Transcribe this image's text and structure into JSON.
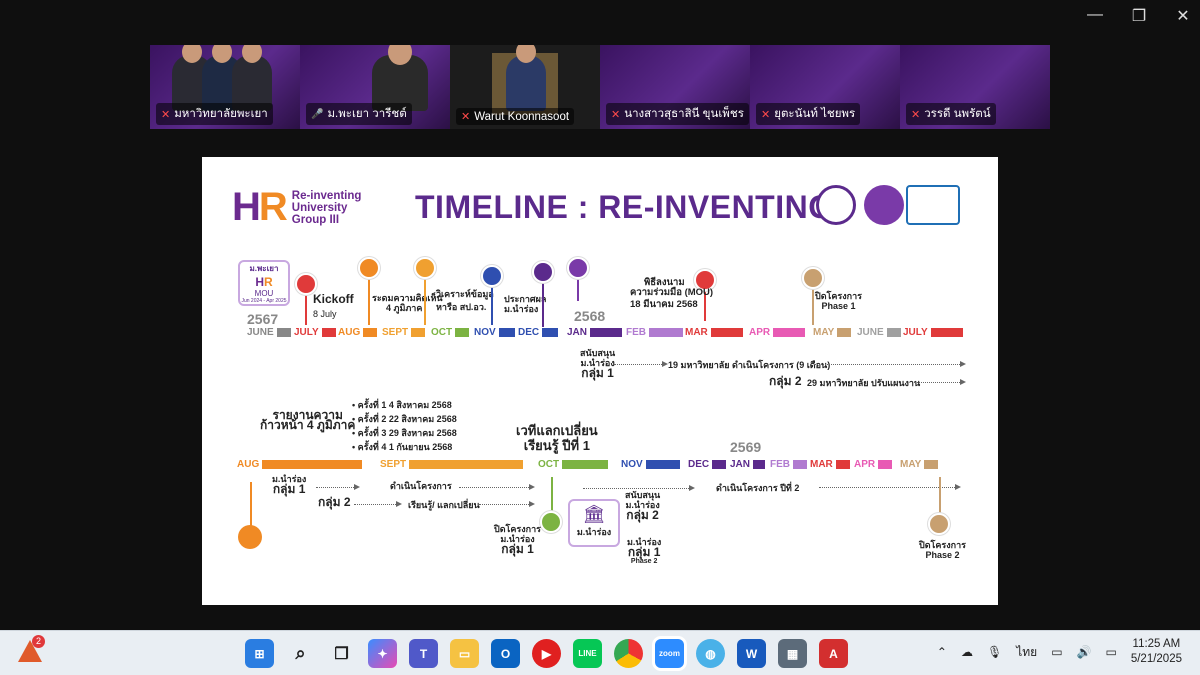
{
  "window_controls": {
    "minimize": "—",
    "restore": "❐",
    "close": "✕"
  },
  "participants": [
    {
      "name": "มหาวิทยาลัยพะเยา",
      "muted": true
    },
    {
      "name": "ม.พะเยา วารีชต์",
      "muted": false
    },
    {
      "name": "Warut Koonnasoot",
      "muted": true
    },
    {
      "name": "นางสาวสุธาสินี ขุนเพ็ชร",
      "muted": true
    },
    {
      "name": "ยุตะนันท์ ไชยพร",
      "muted": true
    },
    {
      "name": "วรรดี นพรัตน์",
      "muted": true
    }
  ],
  "slide": {
    "logo_text": [
      "Re-inventing",
      "University",
      "Group III"
    ],
    "title": "TIMELINE : RE-INVENTING",
    "badge": {
      "top": "ม.พะเยา",
      "bottom": "MOU",
      "dates": "Jun 2024 - Apr 2025"
    },
    "year_2567": "2567",
    "year_2568": "2568",
    "year_2569": "2569",
    "row1_months": [
      "JUNE",
      "JULY",
      "AUG",
      "SEPT",
      "OCT",
      "NOV",
      "DEC",
      "JAN",
      "FEB",
      "MAR",
      "APR",
      "MAY",
      "JUNE",
      "JULY"
    ],
    "kickoff": "Kickoff",
    "kickoff_date": "8 July",
    "ev_aug": [
      "ระดมความคิดเห็น",
      "4 ภูมิภาค"
    ],
    "ev_sept": [
      "วิเคราะห์ข้อมูล",
      "หารือ สป.อว."
    ],
    "ev_nov": [
      "ประกาศผล",
      "ม.นำร่อง"
    ],
    "ev_mou": [
      "พิธีลงนาม",
      "ความร่วมมือ (MOU)",
      "18 มีนาคม 2568"
    ],
    "ev_close1": [
      "ปิดโครงการ",
      "Phase 1"
    ],
    "support1": [
      "สนับสนุน",
      "ม.นำร่อง",
      "กลุ่ม 1"
    ],
    "line19": "19 มหาวิทยาลัย ดำเนินโครงการ (9 เดือน)",
    "group2": "กลุ่ม 2",
    "line29": "29 มหาวิทยาลัย ปรับแผนงาน",
    "report": [
      "รายงานความ",
      "ก้าวหน้า 4 ภูมิภาค"
    ],
    "rounds": [
      "ครั้งที่ 1    4 สิงหาคม  2568",
      "ครั้งที่ 2  22 สิงหาคม  2568",
      "ครั้งที่ 3  29 สิงหาคม  2568",
      "ครั้งที่ 4    1 กันยายน  2568"
    ],
    "forum": [
      "เวทีแลกเปลี่ยน",
      "เรียนรู้ ปีที่ 1"
    ],
    "row2_months": [
      "AUG",
      "SEPT",
      "OCT",
      "NOV",
      "DEC",
      "JAN",
      "FEB",
      "MAR",
      "APR",
      "MAY"
    ],
    "r2_g1": [
      "ม.นำร่อง",
      "กลุ่ม 1"
    ],
    "r2_run": "ดำเนินโครงการ",
    "r2_g2": "กลุ่ม 2",
    "r2_learn": "เรียนรู้/ แลกเปลี่ยน",
    "r2_close": [
      "ปิดโครงการ",
      "ม.นำร่อง",
      "กลุ่ม 1"
    ],
    "r2_uni": "ม.นำร่อง",
    "r2_support": [
      "สนับสนุน",
      "ม.นำร่อง",
      "กลุ่ม 2"
    ],
    "r2_pilot": [
      "ม.นำร่อง",
      "กลุ่ม 1",
      "Phase 2"
    ],
    "r2_year2": "ดำเนินโครงการ ปีที่ 2",
    "r2_close2": [
      "ปิดโครงการ",
      "Phase 2"
    ]
  },
  "taskbar": {
    "notif_count": "2",
    "apps": [
      "start-icon",
      "search-icon",
      "taskview-icon",
      "copilot-icon",
      "teams-icon",
      "explorer-icon",
      "outlook-icon",
      "youtube-icon",
      "line-icon",
      "chrome-icon",
      "zoom-icon",
      "maps-icon",
      "word-icon",
      "calculator-icon",
      "acrobat-icon"
    ],
    "app_labels": {
      "line": "LINE",
      "zoom": "zoom",
      "word": "W"
    },
    "lang": "ไทย",
    "time": "11:25 AM",
    "date": "5/21/2025"
  },
  "colors": {
    "purple": "#5b2a8c",
    "orange": "#f08a24",
    "red": "#e03a3a",
    "green": "#7cb342",
    "blue": "#2f4fb0",
    "pink": "#e85ab4",
    "tan": "#c8a070",
    "gray": "#a0a0a0"
  }
}
